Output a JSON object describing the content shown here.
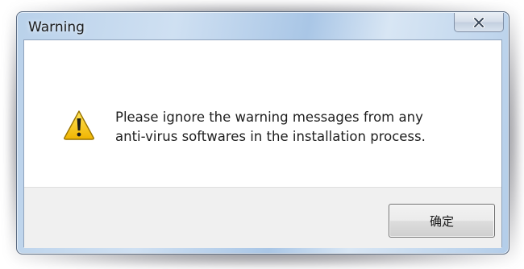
{
  "window": {
    "title": "Warning"
  },
  "dialog": {
    "icon": "warning-triangle-icon",
    "message_line1": "Please ignore the warning messages from any",
    "message_line2": "anti-virus softwares in the installation process."
  },
  "buttons": {
    "ok_label": "确定",
    "close_icon": "close-icon"
  },
  "colors": {
    "titlebar": "#b9d1ea",
    "footer": "#f0f0f0",
    "warning_yellow": "#f5c400"
  }
}
